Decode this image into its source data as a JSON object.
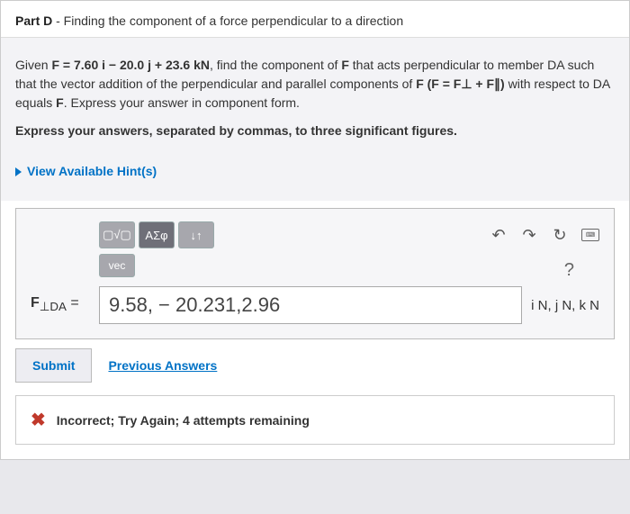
{
  "part": {
    "label": "Part D",
    "title": " - Finding the component of a force perpendicular to a direction"
  },
  "problem": {
    "given_pre": "Given ",
    "given_eq": "F = 7.60 i − 20.0 j + 23.6 kN",
    "given_post": ", find the component of ",
    "given_f": "F",
    "given_rest": " that acts perpendicular to member DA such that the vector addition of the perpendicular and parallel components of ",
    "given_f2": "F (F = F⊥ + F∥)",
    "given_tail": " with respect to DA equals ",
    "given_f3": "F",
    "given_end": ". Express your answer in component form.",
    "instruction": "Express your answers, separated by commas, to three significant figures."
  },
  "hint": {
    "label": "View Available Hint(s)"
  },
  "toolbar": {
    "tmpl": "▢√▢",
    "sym": "ΑΣφ",
    "arrows": "↓↑",
    "vec": "vec"
  },
  "answer": {
    "var_label": "F⊥DA =",
    "value": "9.58, − 20.231,2.96",
    "units": "i N, j N, k N"
  },
  "actions": {
    "submit": "Submit",
    "previous": "Previous Answers"
  },
  "feedback": {
    "text": "Incorrect; Try Again; 4 attempts remaining"
  }
}
